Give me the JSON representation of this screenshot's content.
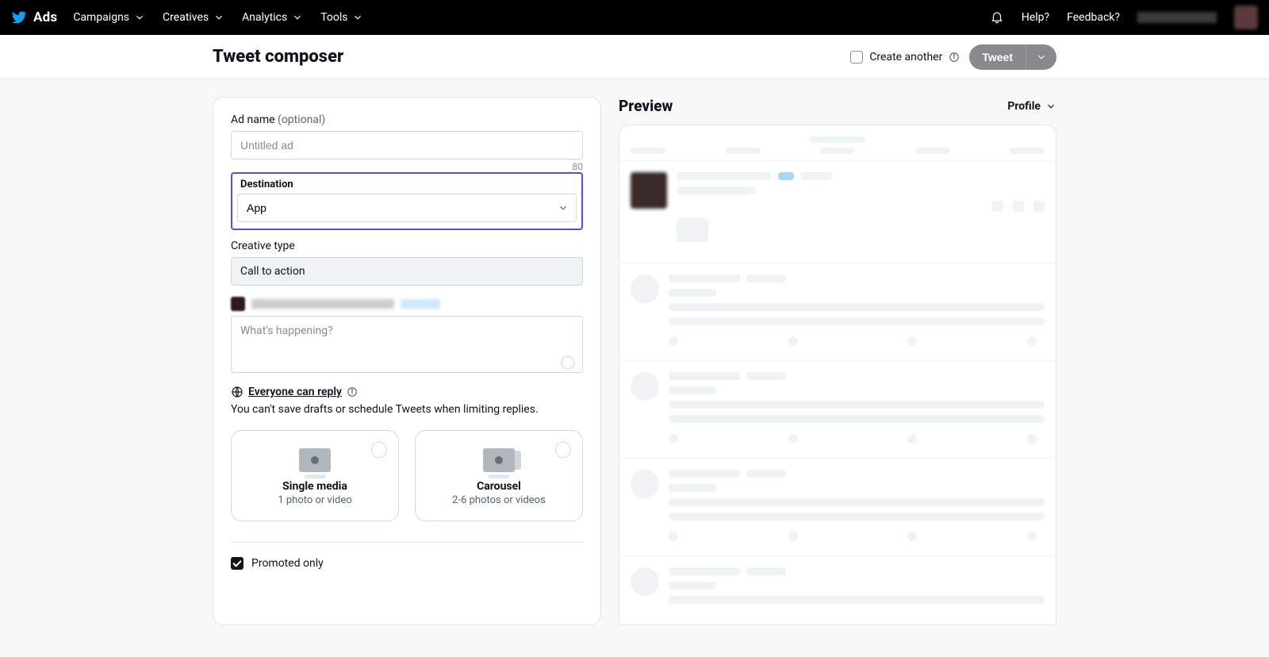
{
  "nav": {
    "product": "Ads",
    "items": [
      "Campaigns",
      "Creatives",
      "Analytics",
      "Tools"
    ],
    "help": "Help?",
    "feedback": "Feedback?"
  },
  "header": {
    "title": "Tweet composer",
    "create_another": "Create another",
    "tweet_button": "Tweet"
  },
  "form": {
    "ad_name_label": "Ad name ",
    "ad_name_optional": "(optional)",
    "ad_name_placeholder": "Untitled ad",
    "ad_name_char_limit": "80",
    "destination_label": "Destination",
    "destination_value": "App",
    "creative_type_label": "Creative type",
    "creative_type_value": "Call to action",
    "tweet_placeholder": "What's happening?",
    "reply_setting": "Everyone can reply",
    "reply_note": "You can't save drafts or schedule Tweets when limiting replies.",
    "media_cards": {
      "single": {
        "title": "Single media",
        "subtitle": "1 photo or video"
      },
      "carousel": {
        "title": "Carousel",
        "subtitle": "2-6 photos or videos"
      }
    },
    "promoted_only": "Promoted only"
  },
  "preview": {
    "heading": "Preview",
    "view": "Profile"
  }
}
